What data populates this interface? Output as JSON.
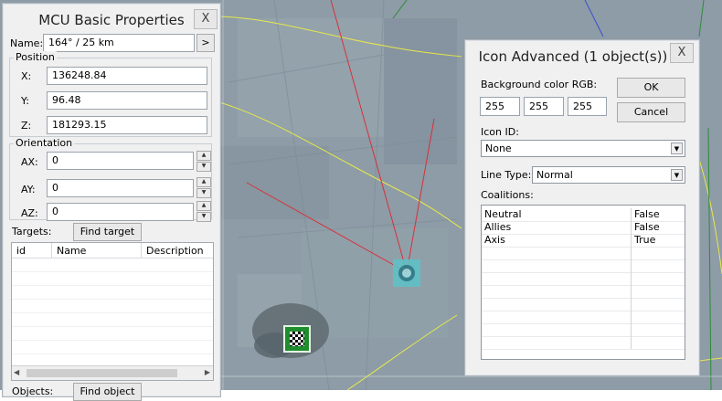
{
  "mcu": {
    "title": "MCU Basic Properties",
    "close": "X",
    "name_label": "Name:",
    "name_value": "164° / 25 km",
    "name_btn": ">",
    "position_title": "Position",
    "x_label": "X:",
    "x_value": "136248.84",
    "y_label": "Y:",
    "y_value": "96.48",
    "z_label": "Z:",
    "z_value": "181293.15",
    "orientation_title": "Orientation",
    "ax_label": "AX:",
    "ax_value": "0",
    "ay_label": "AY:",
    "ay_value": "0",
    "az_label": "AZ:",
    "az_value": "0",
    "targets_label": "Targets:",
    "find_target": "Find target",
    "columns": [
      "id",
      "Name",
      "Description"
    ],
    "objects_label": "Objects:",
    "find_object": "Find object"
  },
  "icon": {
    "title": "Icon Advanced (1 object(s))",
    "close": "X",
    "bg_label": "Background color RGB:",
    "r": "255",
    "g": "255",
    "b": "255",
    "ok": "OK",
    "cancel": "Cancel",
    "icon_id_label": "Icon ID:",
    "icon_id_value": "None",
    "line_type_label": "Line Type:",
    "line_type_value": "Normal",
    "coalitions_label": "Coalitions:",
    "coalitions": [
      {
        "name": "Neutral",
        "value": "False"
      },
      {
        "name": "Allies",
        "value": "False"
      },
      {
        "name": "Axis",
        "value": "True"
      }
    ]
  },
  "colors": {
    "map": "#8a9aa3",
    "route": "#e8e84a",
    "red_line": "#d8303a",
    "icon_marker": "#5fc1c6",
    "object_marker": "#1e8f2c"
  }
}
